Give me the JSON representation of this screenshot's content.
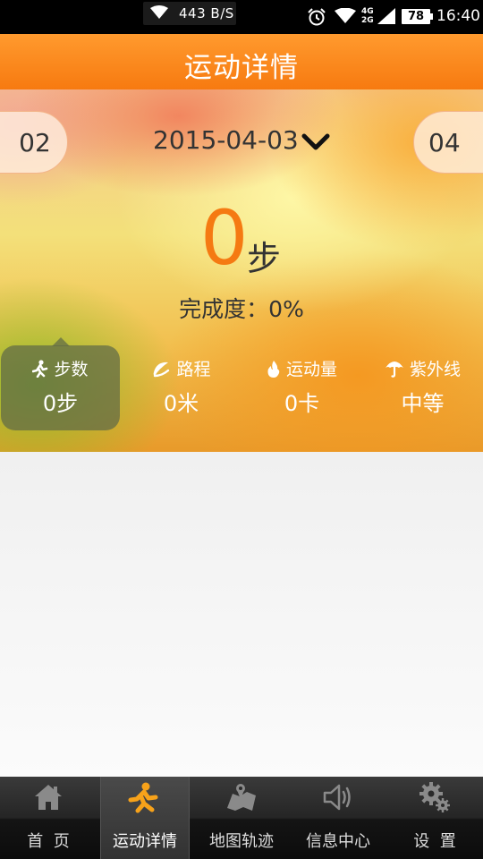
{
  "status_bar": {
    "net_speed": "443 B/S",
    "net_type": "4G\n2G",
    "battery": "78",
    "time": "16:40"
  },
  "header": {
    "title": "运动详情"
  },
  "date_nav": {
    "prev_day": "02",
    "date": "2015-04-03",
    "next_day": "04"
  },
  "summary": {
    "steps": "0",
    "steps_unit": "步",
    "completion_label": "完成度：",
    "completion_value": "0%"
  },
  "stats": [
    {
      "label": "步数",
      "value": "0步",
      "icon": "walker-icon",
      "selected": true
    },
    {
      "label": "路程",
      "value": "0米",
      "icon": "moon-icon",
      "selected": false
    },
    {
      "label": "运动量",
      "value": "0卡",
      "icon": "flame-icon",
      "selected": false
    },
    {
      "label": "紫外线",
      "value": "中等",
      "icon": "umbrella-icon",
      "selected": false
    }
  ],
  "bottom_nav": [
    {
      "label": "首  页",
      "icon": "home-icon",
      "active": false
    },
    {
      "label": "运动详情",
      "icon": "running-person-icon",
      "active": true
    },
    {
      "label": "地图轨迹",
      "icon": "map-icon",
      "active": false
    },
    {
      "label": "信息中心",
      "icon": "speaker-icon",
      "active": false
    },
    {
      "label": "设  置",
      "icon": "gears-icon",
      "active": false
    }
  ],
  "colors": {
    "accent_orange": "#f57a12",
    "title_bar": "#f88a1e",
    "nav_bg": "#1a1a1a"
  }
}
